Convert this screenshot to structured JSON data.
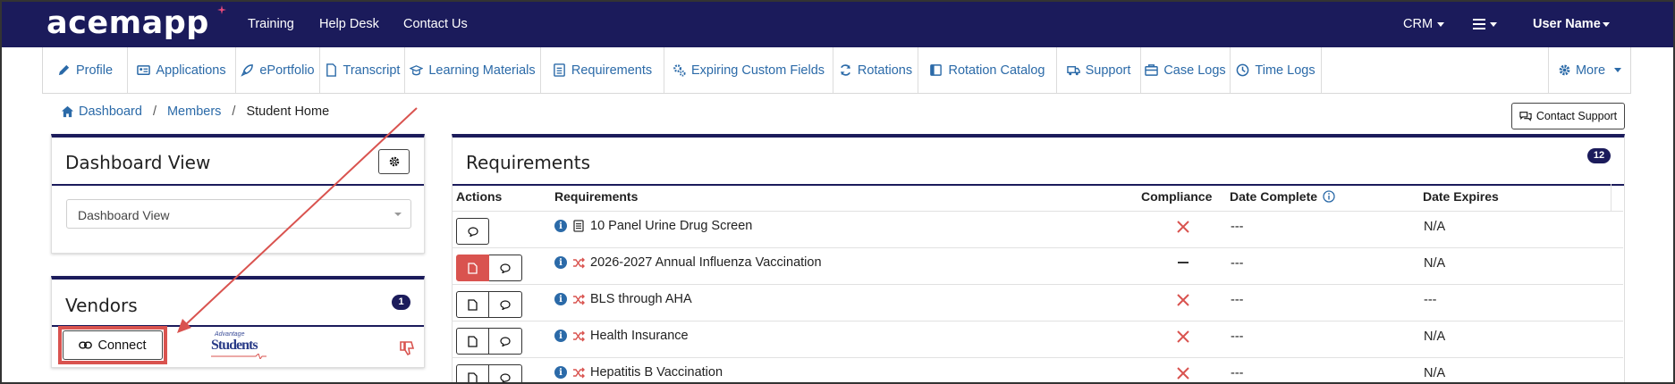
{
  "topnav": {
    "logo": "acemapp",
    "links": [
      "Training",
      "Help Desk",
      "Contact Us"
    ],
    "crm": "CRM",
    "user": "User Name"
  },
  "subnav": {
    "tabs": [
      "Profile",
      "Applications",
      "ePortfolio",
      "Transcript",
      "Learning Materials",
      "Requirements",
      "Expiring Custom Fields",
      "Rotations",
      "Rotation Catalog",
      "Support",
      "Case Logs",
      "Time Logs"
    ],
    "more": "More"
  },
  "breadcrumb": {
    "dashboard": "Dashboard",
    "members": "Members",
    "current": "Student Home"
  },
  "contact_support": "Contact Support",
  "dashboard_card": {
    "title": "Dashboard View",
    "select_value": "Dashboard View"
  },
  "vendors_card": {
    "title": "Vendors",
    "count": "1",
    "connect_label": "Connect",
    "vendor_logo": {
      "line1": "Advantage",
      "line2": "Students"
    }
  },
  "requirements_card": {
    "title": "Requirements",
    "count": "12",
    "headers": {
      "actions": "Actions",
      "requirements": "Requirements",
      "compliance": "Compliance",
      "date_complete": "Date Complete",
      "date_expires": "Date Expires"
    },
    "rows": [
      {
        "name": "10 Panel Urine Drug Screen",
        "compliance": "x",
        "date_complete": "---",
        "date_expires": "N/A"
      },
      {
        "name": "2026-2027 Annual Influenza Vaccination",
        "compliance": "dash",
        "date_complete": "---",
        "date_expires": "N/A"
      },
      {
        "name": "BLS through AHA",
        "compliance": "x",
        "date_complete": "---",
        "date_expires": "---"
      },
      {
        "name": "Health Insurance",
        "compliance": "x",
        "date_complete": "---",
        "date_expires": "N/A"
      },
      {
        "name": "Hepatitis B Vaccination",
        "compliance": "x",
        "date_complete": "---",
        "date_expires": "N/A"
      }
    ]
  },
  "colors": {
    "navy": "#1b1b5b",
    "link": "#2b6aa8",
    "danger": "#d9534f",
    "accent_pink": "#e84a7a"
  }
}
